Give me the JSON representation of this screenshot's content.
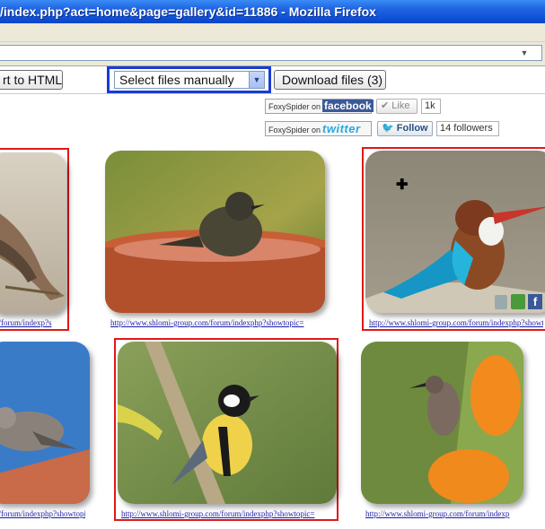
{
  "window": {
    "title": "/index.php?act=home&page=gallery&id=11886 - Mozilla Firefox"
  },
  "toolbar": {
    "export_label": "rt to HTML",
    "select_value": "Select files manually",
    "download_label": "Download files (3)"
  },
  "social": {
    "fb_prefix": "FoxySpider on",
    "fb_brand": "facebook",
    "like_label": "Like",
    "like_count": "1k",
    "tw_prefix": "FoxySpider on",
    "tw_brand": "twitter",
    "follow_label": "Follow",
    "followers": "14 followers"
  },
  "gallery": {
    "items": [
      {
        "link": "//forum/indexp?s",
        "selected": true
      },
      {
        "link": "http://www.shlomi-group.com/forum/indexphp?showtopic=",
        "selected": false
      },
      {
        "link": "http://www.shlomi-group.com/forum/indexphp?showtop",
        "selected": true
      },
      {
        "link": "//forum/indexphp?showtopic",
        "selected": false
      },
      {
        "link": "http://www.shlomi-group.com/forum/indexphp?showtopic=",
        "selected": true
      },
      {
        "link": "http://www.shlomi-group.com/forum/indexp",
        "selected": false
      }
    ]
  },
  "colors": {
    "selection": "#e01818",
    "highlight": "#1a3bd6",
    "link": "#1a1aa8"
  }
}
